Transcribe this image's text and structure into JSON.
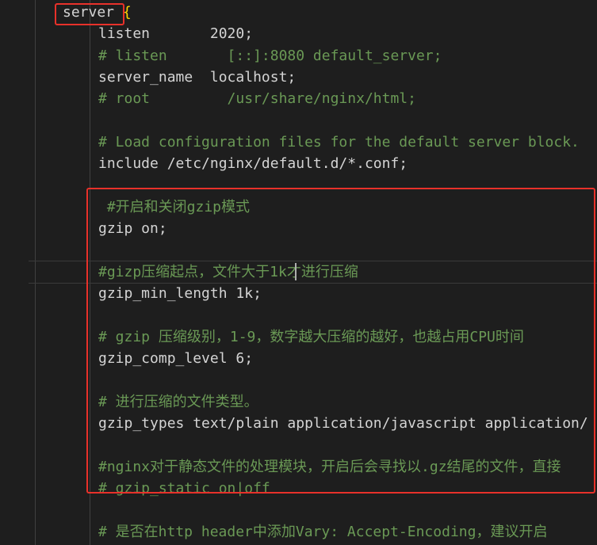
{
  "editor": {
    "lines": [
      {
        "indent": 1,
        "kind": "block",
        "keyword": "server",
        "suffix": " {"
      },
      {
        "indent": 2,
        "kind": "code",
        "text": "listen       2020",
        "end": ";"
      },
      {
        "indent": 2,
        "kind": "comment",
        "text": "# listen       [::]:8080 default_server;"
      },
      {
        "indent": 2,
        "kind": "code",
        "text": "server_name  localhost",
        "end": ";"
      },
      {
        "indent": 2,
        "kind": "comment",
        "text": "# root         /usr/share/nginx/html;"
      },
      {
        "indent": 2,
        "kind": "blank",
        "text": ""
      },
      {
        "indent": 2,
        "kind": "comment",
        "text": "# Load configuration files for the default server block."
      },
      {
        "indent": 2,
        "kind": "code",
        "text": "include /etc/nginx/default.d/*.conf",
        "end": ";"
      },
      {
        "indent": 2,
        "kind": "blank",
        "text": ""
      },
      {
        "indent": 2,
        "kind": "comment",
        "text": " #开启和关闭gzip模式"
      },
      {
        "indent": 2,
        "kind": "code",
        "text": "gzip on",
        "end": ";"
      },
      {
        "indent": 2,
        "kind": "blank",
        "text": ""
      },
      {
        "indent": 2,
        "kind": "comment",
        "text": "#gizp压缩起点，文件大于1k才进行压缩"
      },
      {
        "indent": 2,
        "kind": "code",
        "text": "gzip_min_length 1k",
        "end": ";"
      },
      {
        "indent": 2,
        "kind": "blank",
        "text": ""
      },
      {
        "indent": 2,
        "kind": "comment",
        "text": "# gzip 压缩级别，1-9，数字越大压缩的越好，也越占用CPU时间"
      },
      {
        "indent": 2,
        "kind": "code",
        "text": "gzip_comp_level 6",
        "end": ";"
      },
      {
        "indent": 2,
        "kind": "blank",
        "text": ""
      },
      {
        "indent": 2,
        "kind": "comment",
        "text": "# 进行压缩的文件类型。"
      },
      {
        "indent": 2,
        "kind": "code",
        "text": "gzip_types text/plain application/javascript application/",
        "end": ""
      },
      {
        "indent": 2,
        "kind": "blank",
        "text": ""
      },
      {
        "indent": 2,
        "kind": "comment",
        "text": "#nginx对于静态文件的处理模块，开启后会寻找以.gz结尾的文件，直接"
      },
      {
        "indent": 2,
        "kind": "comment",
        "text": "# gzip_static on|off"
      },
      {
        "indent": 2,
        "kind": "blank",
        "text": ""
      },
      {
        "indent": 2,
        "kind": "comment",
        "text": "# 是否在http header中添加Vary: Accept-Encoding，建议开启"
      }
    ]
  },
  "colors": {
    "background": "#1e1e1e",
    "text": "#d4d4d4",
    "comment": "#6a9955",
    "brace": "#ffd700",
    "annotation_red": "#e8312a"
  }
}
